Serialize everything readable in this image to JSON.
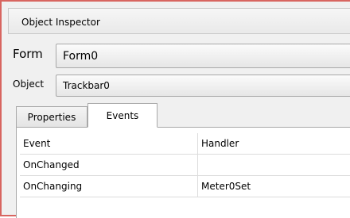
{
  "window": {
    "title": "Object Inspector"
  },
  "form_selector": {
    "label": "Form",
    "value": "Form0"
  },
  "object_selector": {
    "label": "Object",
    "value": "Trackbar0"
  },
  "tabs": [
    {
      "label": "Properties",
      "active": false
    },
    {
      "label": "Events",
      "active": true
    }
  ],
  "events_grid": {
    "columns": [
      "Event",
      "Handler"
    ],
    "rows": [
      {
        "event": "OnChanged",
        "handler": ""
      },
      {
        "event": "OnChanging",
        "handler": "Meter0Set"
      }
    ]
  },
  "colors": {
    "window_border": "#d86560",
    "panel_background": "#ffffff",
    "chrome_background": "#f0f0f0"
  }
}
